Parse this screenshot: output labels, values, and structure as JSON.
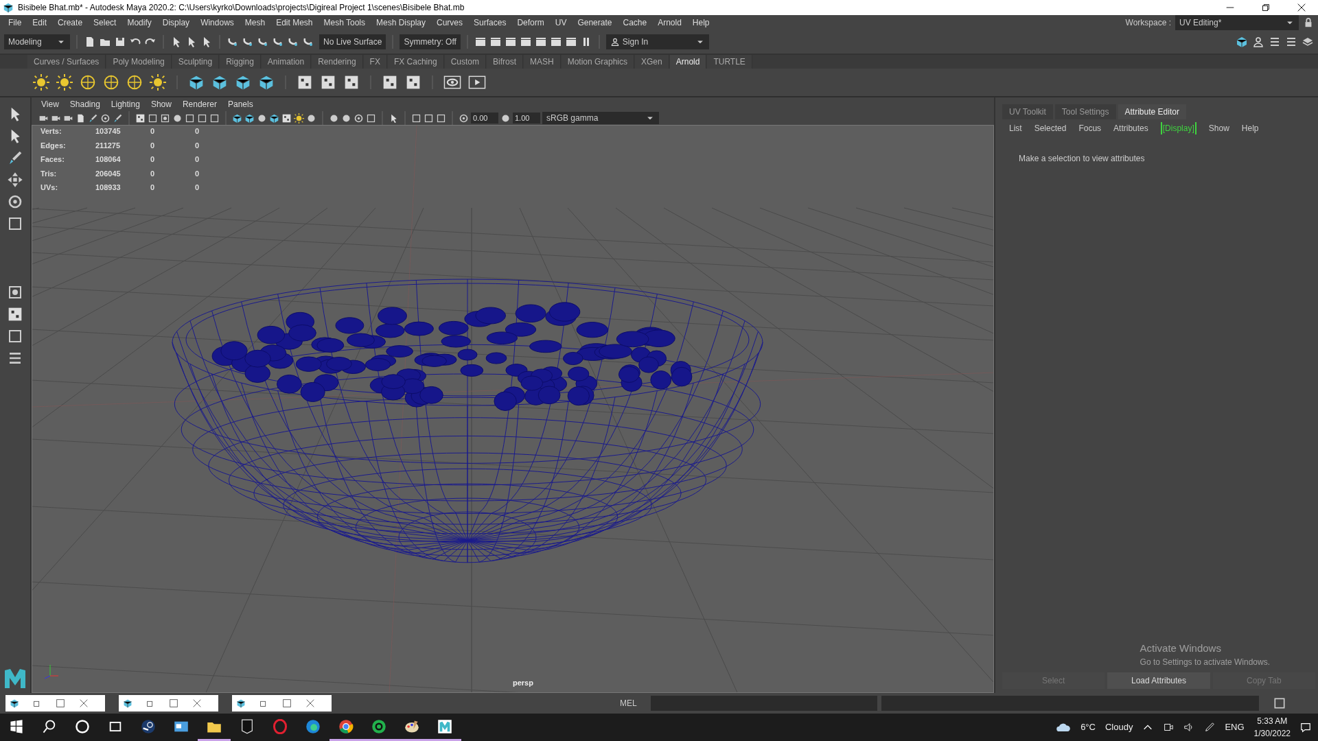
{
  "title_bar": {
    "title": "Bisibele Bhat.mb* - Autodesk Maya 2020.2: C:\\Users\\kyrko\\Downloads\\projects\\Digireal Project 1\\scenes\\Bisibele Bhat.mb"
  },
  "menu_bar": [
    "File",
    "Edit",
    "Create",
    "Select",
    "Modify",
    "Display",
    "Windows",
    "Mesh",
    "Edit Mesh",
    "Mesh Tools",
    "Mesh Display",
    "Curves",
    "Surfaces",
    "Deform",
    "UV",
    "Generate",
    "Cache",
    "Arnold",
    "Help"
  ],
  "status_line": {
    "mode": "Modeling",
    "live_surface": "No Live Surface",
    "symmetry": "Symmetry: Off",
    "sign_in": "Sign In",
    "workspace_label": "Workspace :",
    "workspace": "UV Editing*"
  },
  "shelf_tabs": [
    {
      "label": "Curves / Surfaces",
      "selected": false
    },
    {
      "label": "Poly Modeling",
      "selected": false
    },
    {
      "label": "Sculpting",
      "selected": false
    },
    {
      "label": "Rigging",
      "selected": false
    },
    {
      "label": "Animation",
      "selected": false
    },
    {
      "label": "Rendering",
      "selected": false
    },
    {
      "label": "FX",
      "selected": false
    },
    {
      "label": "FX Caching",
      "selected": false
    },
    {
      "label": "Custom",
      "selected": false
    },
    {
      "label": "Bifrost",
      "selected": false
    },
    {
      "label": "MASH",
      "selected": false
    },
    {
      "label": "Motion Graphics",
      "selected": false
    },
    {
      "label": "XGen",
      "selected": false
    },
    {
      "label": "Arnold",
      "selected": true
    },
    {
      "label": "TURTLE",
      "selected": false
    }
  ],
  "viewport": {
    "menu": [
      "View",
      "Shading",
      "Lighting",
      "Show",
      "Renderer",
      "Panels"
    ],
    "exposure": "0.00",
    "gamma": "1.00",
    "color_space": "sRGB gamma",
    "stats": [
      {
        "label": "Verts:",
        "values": [
          "103745",
          "0",
          "0"
        ]
      },
      {
        "label": "Edges:",
        "values": [
          "211275",
          "0",
          "0"
        ]
      },
      {
        "label": "Faces:",
        "values": [
          "108064",
          "0",
          "0"
        ]
      },
      {
        "label": "Tris:",
        "values": [
          "206045",
          "0",
          "0"
        ]
      },
      {
        "label": "UVs:",
        "values": [
          "108933",
          "0",
          "0"
        ]
      }
    ],
    "camera": "persp"
  },
  "right_panel": {
    "tabs": [
      {
        "label": "UV Toolkit",
        "selected": false
      },
      {
        "label": "Tool Settings",
        "selected": false
      },
      {
        "label": "Attribute Editor",
        "selected": true
      }
    ],
    "menu": [
      {
        "label": "List",
        "active": false
      },
      {
        "label": "Selected",
        "active": false
      },
      {
        "label": "Focus",
        "active": false
      },
      {
        "label": "Attributes",
        "active": false
      },
      {
        "label": "[Display]",
        "active": true
      },
      {
        "label": "Show",
        "active": false
      },
      {
        "label": "Help",
        "active": false
      }
    ],
    "message": "Make a selection to view attributes",
    "buttons": [
      {
        "label": "Select",
        "disabled": true
      },
      {
        "label": "Load Attributes",
        "disabled": false
      },
      {
        "label": "Copy Tab",
        "disabled": true
      }
    ]
  },
  "command_line": {
    "language": "MEL"
  },
  "activation_notice": {
    "title": "Activate Windows",
    "text": "Go to Settings to activate Windows."
  },
  "taskbar": {
    "apps": [
      {
        "kind": "start",
        "open": false
      },
      {
        "kind": "search",
        "open": false
      },
      {
        "kind": "cortana",
        "open": false
      },
      {
        "kind": "taskview",
        "open": false
      },
      {
        "kind": "steam",
        "open": false
      },
      {
        "kind": "control",
        "open": false
      },
      {
        "kind": "explorer",
        "open": true
      },
      {
        "kind": "epic",
        "open": false
      },
      {
        "kind": "opera",
        "open": false
      },
      {
        "kind": "edge",
        "open": false
      },
      {
        "kind": "chrome",
        "open": true
      },
      {
        "kind": "green",
        "open": true
      },
      {
        "kind": "paint",
        "open": true
      },
      {
        "kind": "maya",
        "open": true
      }
    ],
    "temperature": "6°C",
    "weather": "Cloudy",
    "language": "ENG",
    "time": "5:33 AM",
    "date": "1/30/2022"
  }
}
